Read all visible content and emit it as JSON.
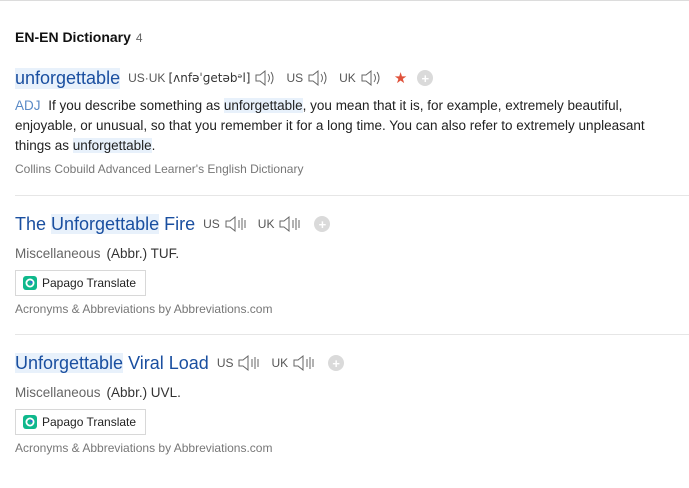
{
  "dictionary": {
    "title": "EN-EN Dictionary",
    "count": "4"
  },
  "entries": [
    {
      "headword": "unforgettable",
      "pron_us_uk_label": "US·UK",
      "phonetic": "[ʌnfəˈɡetəbᵊl]",
      "us_label": "US",
      "uk_label": "UK",
      "pos": "ADJ",
      "def_1": " If you describe something as ",
      "def_hl_1": "unforgettable",
      "def_2": ", you mean that it is, for example, extremely beautiful, enjoyable, or unusual, so that you remember it for a long time. You can also refer to extremely unpleasant things as ",
      "def_hl_2": "unforgettable",
      "def_3": ".",
      "source": "Collins Cobuild Advanced Learner's English Dictionary"
    },
    {
      "headword_pre": "The",
      "headword_hl": "Unforgettable",
      "headword_post": "Fire",
      "us_label": "US",
      "uk_label": "UK",
      "category": "Miscellaneous",
      "abbr": "(Abbr.) TUF.",
      "papago_label": "Papago Translate",
      "source": "Acronyms & Abbreviations by Abbreviations.com"
    },
    {
      "headword_hl": "Unforgettable",
      "headword_post": "Viral Load",
      "us_label": "US",
      "uk_label": "UK",
      "category": "Miscellaneous",
      "abbr": "(Abbr.) UVL.",
      "papago_label": "Papago Translate",
      "source": "Acronyms & Abbreviations by Abbreviations.com"
    }
  ],
  "icons": {
    "speaker": "speaker-icon",
    "star": "star-icon",
    "add": "plus-icon",
    "papago": "papago-logo-icon"
  },
  "colors": {
    "headword": "#1a4fa0",
    "highlight": "#e8f1fb",
    "star": "#e0523b",
    "pos": "#5a8ac6"
  },
  "glyphs": {
    "star": "★",
    "plus": "+"
  }
}
